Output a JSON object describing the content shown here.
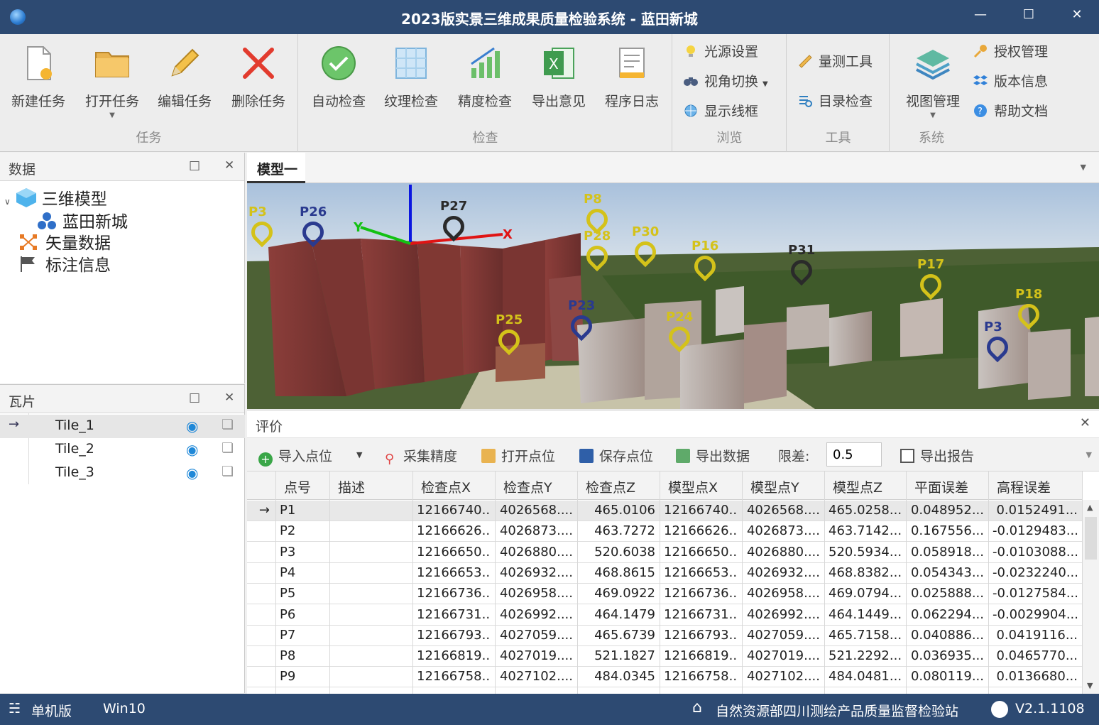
{
  "window": {
    "title": "2023版实景三维成果质量检验系统 - 蓝田新城"
  },
  "ribbon": {
    "groups": {
      "task": "任务",
      "check": "检查",
      "browse": "浏览",
      "tools": "工具",
      "system": "系统"
    },
    "buttons": {
      "new_task": "新建任务",
      "open_task": "打开任务",
      "edit_task": "编辑任务",
      "delete_task": "删除任务",
      "auto_check": "自动检查",
      "texture_check": "纹理检查",
      "precision_check": "精度检查",
      "export_opinion": "导出意见",
      "program_log": "程序日志",
      "light_settings": "光源设置",
      "view_switch": "视角切换",
      "show_wireframe": "显示线框",
      "measure_tool": "量测工具",
      "catalog_check": "目录检查",
      "view_manage": "视图管理",
      "license_manage": "授权管理",
      "version_info": "版本信息",
      "help_doc": "帮助文档"
    }
  },
  "data_panel": {
    "title": "数据",
    "tree": {
      "root": "三维模型",
      "child": "蓝田新城",
      "vector": "矢量数据",
      "annotation": "标注信息"
    }
  },
  "tile_panel": {
    "title": "瓦片",
    "tiles": [
      "Tile_1",
      "Tile_2",
      "Tile_3"
    ]
  },
  "doc_tab": {
    "label": "模型一"
  },
  "viewport": {
    "pins": [
      {
        "label": "P3",
        "color": "#d4c21a"
      },
      {
        "label": "P26",
        "color": "#2a3a8f"
      },
      {
        "label": "P27",
        "color": "#2a2a2a"
      },
      {
        "label": "P8",
        "color": "#d4c21a"
      },
      {
        "label": "P28",
        "color": "#d4c21a"
      },
      {
        "label": "P30",
        "color": "#d4c21a"
      },
      {
        "label": "P16",
        "color": "#d4c21a"
      },
      {
        "label": "P31",
        "color": "#2a2a2a"
      },
      {
        "label": "P17",
        "color": "#d4c21a"
      },
      {
        "label": "P18",
        "color": "#d4c21a"
      },
      {
        "label": "P25",
        "color": "#d4c21a"
      },
      {
        "label": "P23",
        "color": "#2a3a8f"
      },
      {
        "label": "P24",
        "color": "#d4c21a"
      },
      {
        "label": "P3",
        "color": "#2a3a8f"
      }
    ],
    "axis_x": "X",
    "axis_y": "Y"
  },
  "eval_panel": {
    "title": "评价",
    "toolbar": {
      "import_points": "导入点位",
      "collect_precision": "采集精度",
      "open_points": "打开点位",
      "save_points": "保存点位",
      "export_data": "导出数据",
      "tolerance_label": "限差:",
      "tolerance_value": "0.5",
      "export_report": "导出报告"
    },
    "columns": [
      "点号",
      "描述",
      "检查点X",
      "检查点Y",
      "检查点Z",
      "模型点X",
      "模型点Y",
      "模型点Z",
      "平面误差",
      "高程误差"
    ],
    "rows": [
      [
        "P1",
        "",
        "12166740...",
        "4026568....",
        "465.0106",
        "12166740...",
        "4026568....",
        "465.0258...",
        "0.048952...",
        "0.0152491..."
      ],
      [
        "P2",
        "",
        "12166626...",
        "4026873....",
        "463.7272",
        "12166626...",
        "4026873....",
        "463.7142...",
        "0.167556...",
        "-0.0129483..."
      ],
      [
        "P3",
        "",
        "12166650...",
        "4026880....",
        "520.6038",
        "12166650...",
        "4026880....",
        "520.5934...",
        "0.058918...",
        "-0.0103088..."
      ],
      [
        "P4",
        "",
        "12166653...",
        "4026932....",
        "468.8615",
        "12166653...",
        "4026932....",
        "468.8382...",
        "0.054343...",
        "-0.0232240..."
      ],
      [
        "P5",
        "",
        "12166736...",
        "4026958....",
        "469.0922",
        "12166736...",
        "4026958....",
        "469.0794...",
        "0.025888...",
        "-0.0127584..."
      ],
      [
        "P6",
        "",
        "12166731...",
        "4026992....",
        "464.1479",
        "12166731...",
        "4026992....",
        "464.1449...",
        "0.062294...",
        "-0.0029904..."
      ],
      [
        "P7",
        "",
        "12166793...",
        "4027059....",
        "465.6739",
        "12166793...",
        "4027059....",
        "465.7158...",
        "0.040886...",
        "0.0419116..."
      ],
      [
        "P8",
        "",
        "12166819...",
        "4027019....",
        "521.1827",
        "12166819...",
        "4027019....",
        "521.2292...",
        "0.036935...",
        "0.0465770..."
      ],
      [
        "P9",
        "",
        "12166758...",
        "4027102....",
        "484.0345",
        "12166758...",
        "4027102....",
        "484.0481...",
        "0.080119...",
        "0.0136680..."
      ]
    ]
  },
  "status": {
    "mode": "单机版",
    "os": "Win10",
    "org": "自然资源部四川测绘产品质量监督检验站",
    "version": "V2.1.1108"
  }
}
